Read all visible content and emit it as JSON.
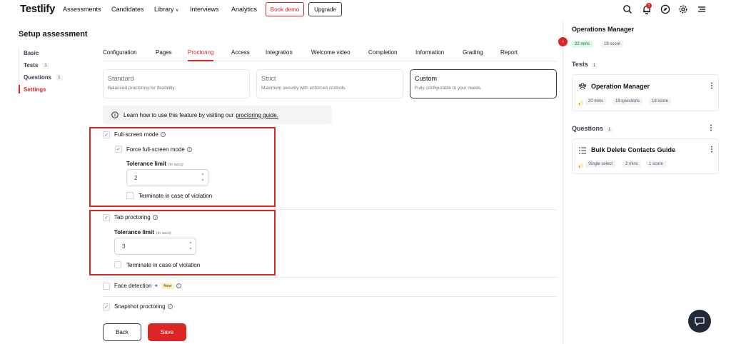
{
  "nav": {
    "logo": "Testlify",
    "links": [
      "Assessments",
      "Candidates",
      "Library",
      "Interviews",
      "Analytics"
    ],
    "library_caret": "∨",
    "book_demo": "Book demo",
    "upgrade": "Upgrade",
    "notification_count": "1"
  },
  "sidebar": {
    "title": "Setup assessment",
    "items": [
      {
        "label": "Basic",
        "count": ""
      },
      {
        "label": "Tests",
        "count": "1"
      },
      {
        "label": "Questions",
        "count": "1"
      },
      {
        "label": "Settings",
        "count": ""
      }
    ]
  },
  "tabs": [
    "Configuration",
    "Pages",
    "Proctoring",
    "Access",
    "Integration",
    "Welcome video",
    "Completion",
    "Information",
    "Grading",
    "Report"
  ],
  "modes": [
    {
      "title": "Standard",
      "desc": "Balanced proctoring for flexibility."
    },
    {
      "title": "Strict",
      "desc": "Maximum security with enforced controls."
    },
    {
      "title": "Custom",
      "desc": "Fully configurable to your needs."
    }
  ],
  "info": {
    "text": "Learn how to use this feature by visiting our",
    "link": "proctoring guide."
  },
  "fullscreen": {
    "label": "Full-screen mode",
    "force_label": "Force full-screen mode",
    "tolerance_label": "Tolerance limit",
    "tolerance_unit": "(in secs)",
    "tolerance_value": "2",
    "terminate_label": "Terminate in case of violation"
  },
  "tab_proctoring": {
    "label": "Tab proctoring",
    "tolerance_label": "Tolerance limit",
    "tolerance_unit": "(in secs)",
    "tolerance_value": "3",
    "terminate_label": "Terminate in case of violation"
  },
  "face_detection": {
    "label": "Face detection",
    "badge": "New"
  },
  "snapshot": {
    "label": "Snapshot proctoring"
  },
  "actions": {
    "back": "Back",
    "save": "Save"
  },
  "right_panel": {
    "title": "Operations Manager",
    "duration": "22 mins",
    "score": "19 score",
    "tests_label": "Tests",
    "tests_count": "1",
    "test_card": {
      "title": "Operation Manager",
      "duration": "20 mins",
      "questions": "18 questions",
      "score": "18 score"
    },
    "questions_label": "Questions",
    "questions_count": "1",
    "question_card": {
      "title": "Bulk Delete Contacts Guide",
      "type": "Single select",
      "duration": "2 mins",
      "score": "1 score"
    }
  },
  "colors": {
    "accent": "#dc2626",
    "highlight_box": "#dc2626"
  }
}
